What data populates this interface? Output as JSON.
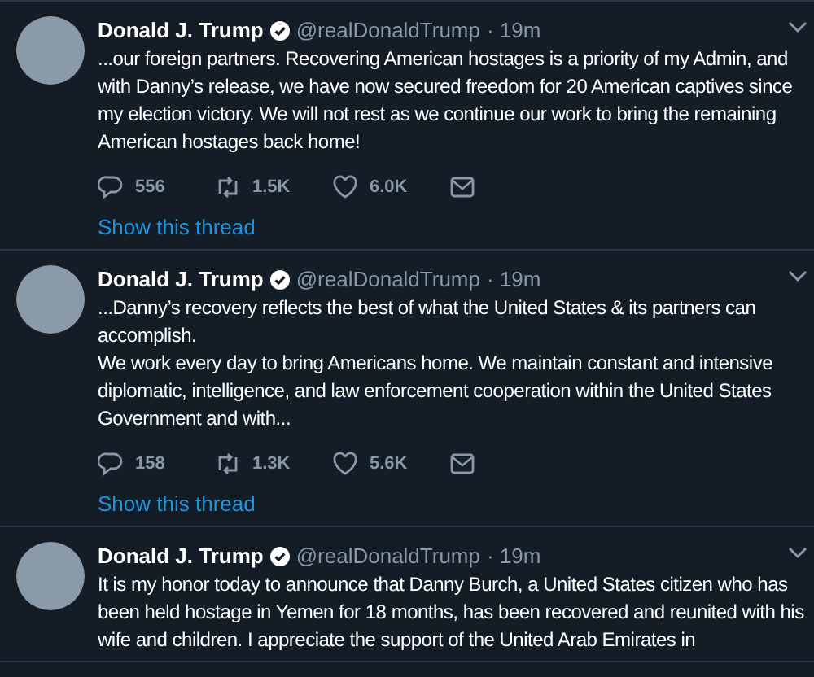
{
  "tweets": [
    {
      "name": "Donald J. Trump",
      "verified": true,
      "handle": "@realDonaldTrump",
      "time": "· 19m",
      "text": "...our foreign partners. Recovering American hostages is a priority of my Admin, and with Danny’s release, we have now secured freedom for 20 American captives since my election victory. We will not rest as we continue our work to bring the remaining American hostages back home!",
      "replies": "556",
      "retweets": "1.5K",
      "likes": "6.0K",
      "thread_link": "Show this thread"
    },
    {
      "name": "Donald J. Trump",
      "verified": true,
      "handle": "@realDonaldTrump",
      "time": "· 19m",
      "text": "...Danny’s recovery reflects the best of what the United States & its partners can accomplish.\nWe work every day to bring Americans home. We maintain constant and intensive diplomatic, intelligence, and law enforcement cooperation within the United States Government and with...",
      "replies": "158",
      "retweets": "1.3K",
      "likes": "5.6K",
      "thread_link": "Show this thread"
    },
    {
      "name": "Donald J. Trump",
      "verified": true,
      "handle": "@realDonaldTrump",
      "time": "· 19m",
      "text": "It is my honor today to announce that Danny Burch, a United States citizen who has been held hostage in Yemen for 18 months, has been recovered and reunited with his wife and children. I appreciate the support of the United Arab Emirates in"
    }
  ]
}
